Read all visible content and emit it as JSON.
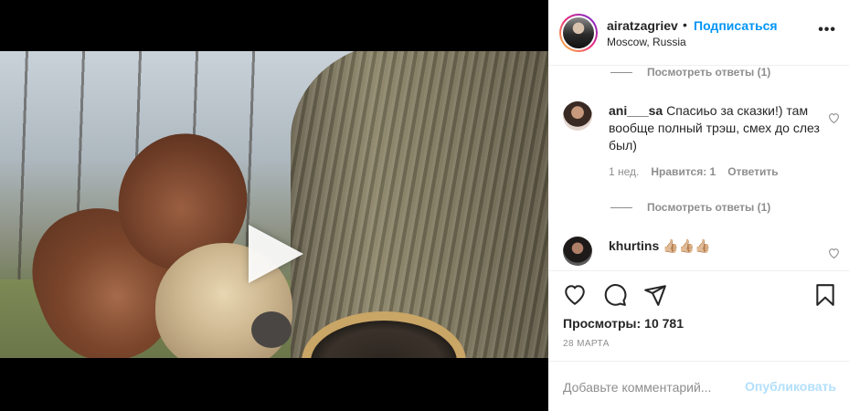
{
  "post": {
    "username": "airatzagriev",
    "separator": "•",
    "follow_label": "Подписаться",
    "location": "Moscow, Russia",
    "more_label": "•••"
  },
  "comments": {
    "view_replies_1": "Посмотреть ответы (1)",
    "items": [
      {
        "user": "ani___sa",
        "text": "Спасиьо за сказки!) там вообще полный трэш, смех до слез был)",
        "time": "1 нед.",
        "likes": "Нравится: 1",
        "reply": "Ответить",
        "view_replies": "Посмотреть ответы (1)"
      },
      {
        "user": "khurtins",
        "text": "👍🏼👍🏼👍🏼"
      }
    ]
  },
  "actions": {
    "icons": [
      "heart-icon",
      "comment-icon",
      "share-icon",
      "bookmark-icon"
    ]
  },
  "stats": {
    "views_label": "Просмотры:",
    "views_value": "10 781",
    "date": "28 марта"
  },
  "add_comment": {
    "placeholder": "Добавьте комментарий...",
    "publish_label": "Опубликовать"
  },
  "colors": {
    "accent": "#0095f6",
    "publish_disabled": "#b2dffc",
    "muted": "#8e8e8e"
  }
}
